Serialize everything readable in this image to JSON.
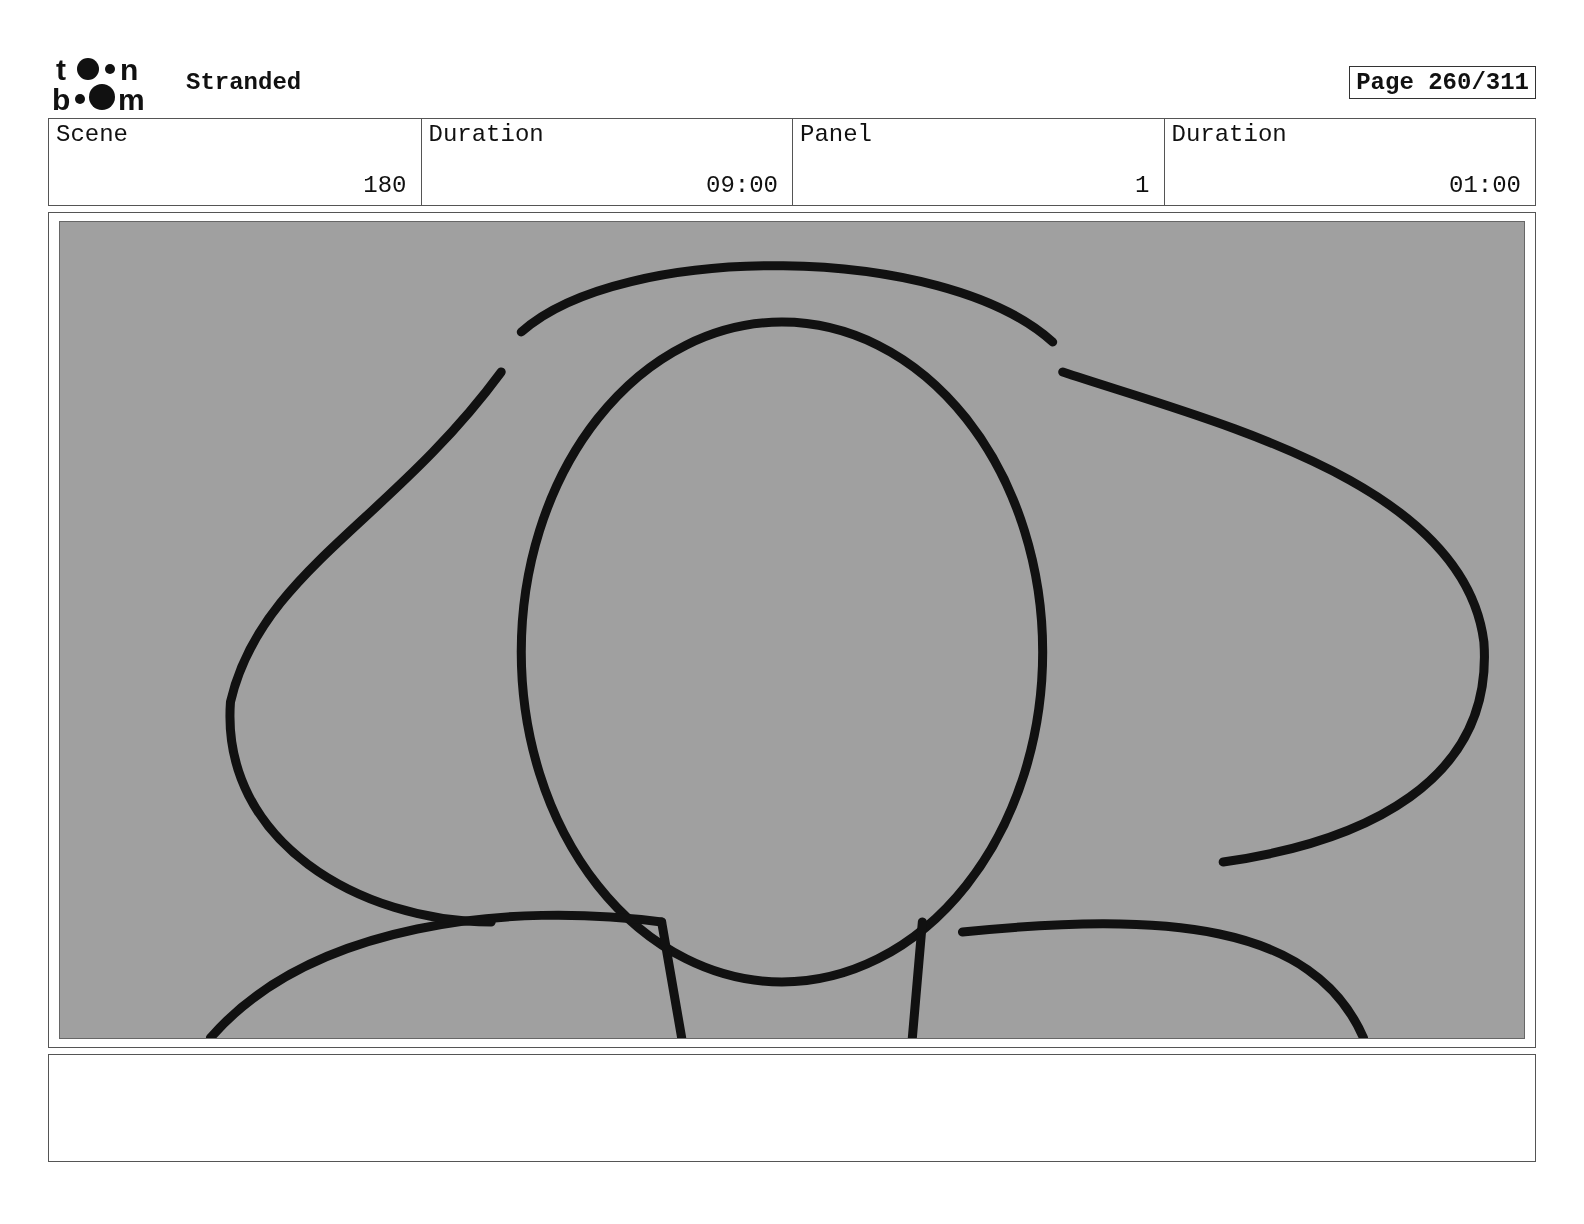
{
  "logo": {
    "top": [
      "t",
      "n"
    ],
    "bottom": [
      "b",
      "m"
    ]
  },
  "title": "Stranded",
  "page": "Page 260/311",
  "fields": [
    {
      "label": "Scene",
      "value": "180"
    },
    {
      "label": "Duration",
      "value": "09:00"
    },
    {
      "label": "Panel",
      "value": "1"
    },
    {
      "label": "Duration",
      "value": "01:00"
    }
  ]
}
